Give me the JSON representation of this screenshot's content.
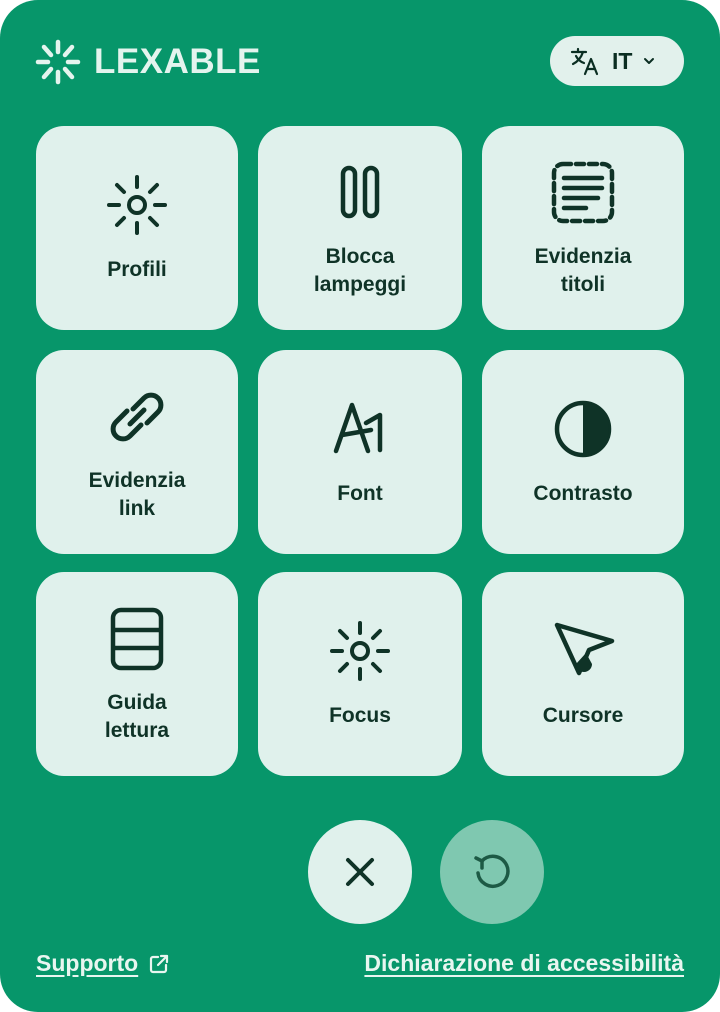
{
  "brand": {
    "name": "LEXABLE",
    "logo_icon": "burst-logo-icon"
  },
  "language": {
    "code": "IT",
    "icon": "translate-icon"
  },
  "tiles": [
    {
      "label": "Profili",
      "icon": "sun-icon"
    },
    {
      "label": "Blocca\nlampeggi",
      "icon": "pause-icon"
    },
    {
      "label": "Evidenzia\ntitoli",
      "icon": "heading-highlight-icon"
    },
    {
      "label": "Evidenzia\nlink",
      "icon": "link-icon"
    },
    {
      "label": "Font",
      "icon": "font-icon"
    },
    {
      "label": "Contrasto",
      "icon": "contrast-icon"
    },
    {
      "label": "Guida\nlettura",
      "icon": "reading-guide-icon"
    },
    {
      "label": "Focus",
      "icon": "sun-icon"
    },
    {
      "label": "Cursore",
      "icon": "cursor-icon"
    }
  ],
  "actions": {
    "close_icon": "close-icon",
    "reset_icon": "reset-icon"
  },
  "footer": {
    "support_label": "Supporto",
    "support_icon": "external-link-icon",
    "declaration_label": "Dichiarazione di accessibilità"
  },
  "colors": {
    "panel": "#07966a",
    "tile": "#e0f1ec",
    "text_dark": "#0f3327",
    "reset_button": "#7fc8b0"
  }
}
